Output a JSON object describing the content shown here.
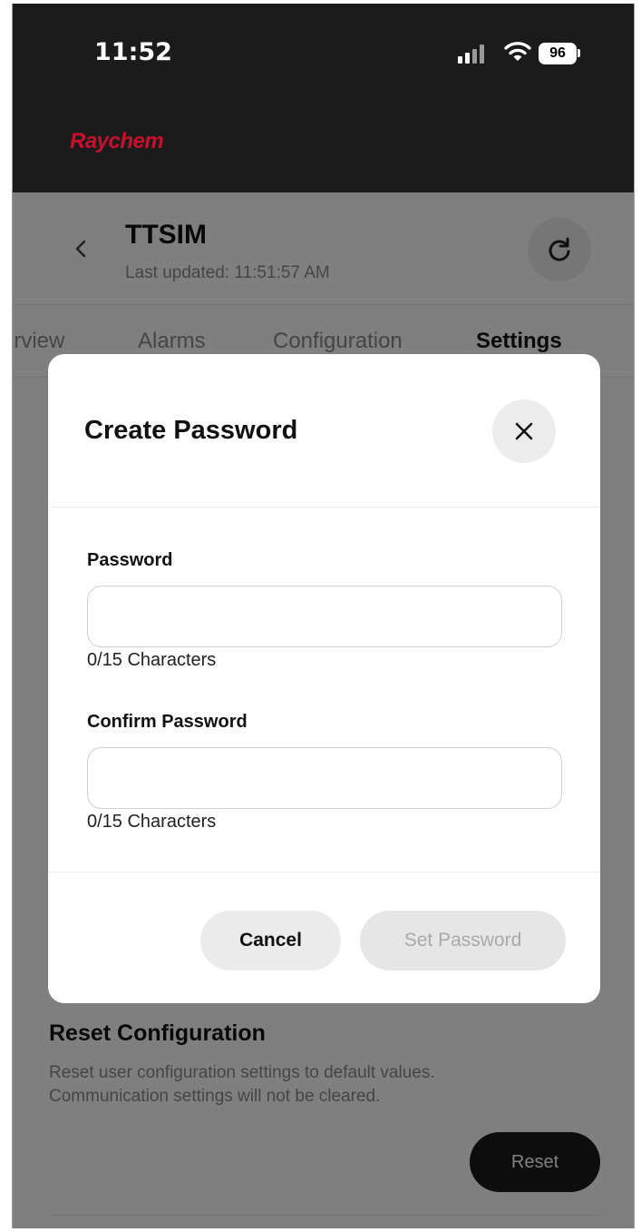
{
  "status_bar": {
    "time": "11:52",
    "battery": "96"
  },
  "brand": {
    "name": "Raychem",
    "color": "#c8102e"
  },
  "device_header": {
    "name": "TTSIM",
    "last_updated": "Last updated: 11:51:57 AM"
  },
  "tabs": [
    {
      "label": "erview",
      "active": false
    },
    {
      "label": "Alarms",
      "active": false
    },
    {
      "label": "Configuration",
      "active": false
    },
    {
      "label": "Settings",
      "active": true
    }
  ],
  "reset_section": {
    "title": "Reset Configuration",
    "description": "Reset user configuration settings to default values. Communication settings will not be cleared.",
    "button_label": "Reset"
  },
  "modal": {
    "title": "Create Password",
    "password": {
      "label": "Password",
      "value": "",
      "counter": "0/15 Characters"
    },
    "confirm_password": {
      "label": "Confirm Password",
      "value": "",
      "counter": "0/15 Characters"
    },
    "cancel_label": "Cancel",
    "submit_label": "Set Password"
  },
  "icons": {
    "back": "chevron-left-icon",
    "refresh": "refresh-icon",
    "close": "close-icon",
    "signal": "signal-icon",
    "wifi": "wifi-icon"
  }
}
